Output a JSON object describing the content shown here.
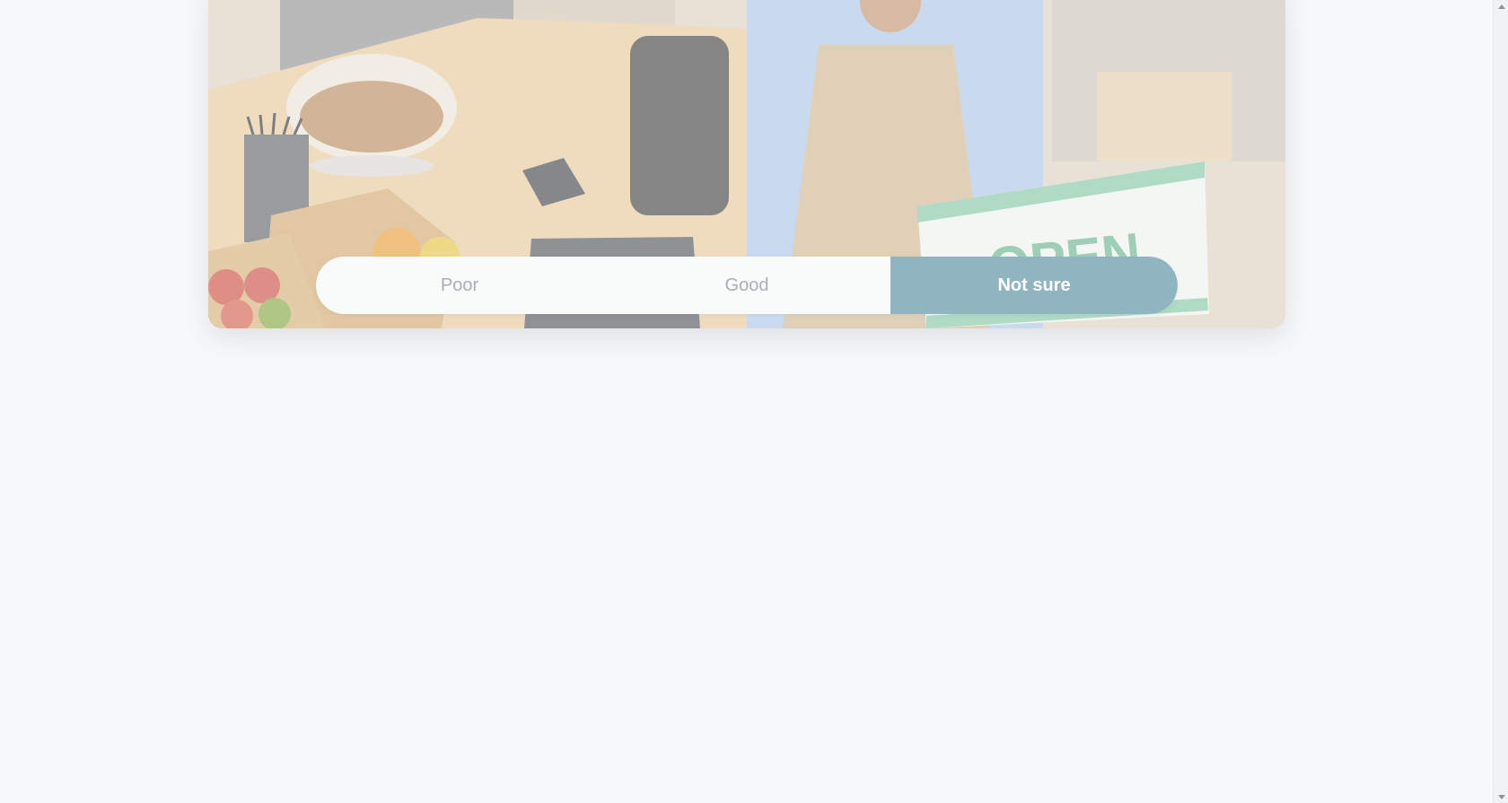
{
  "hero": {
    "image_name": "shop-owner-holding-open-sign",
    "sign_text": "OPEN"
  },
  "rating": {
    "options": [
      "Poor",
      "Good",
      "Not sure"
    ],
    "selected": "Not sure",
    "colors": {
      "selected_bg": "#8fb5c0",
      "selected_text": "#ffffff",
      "unselected_text": "#a9afb4"
    }
  },
  "scrollbar": {
    "up_icon": "chevron-up-icon",
    "down_icon": "chevron-down-icon"
  }
}
